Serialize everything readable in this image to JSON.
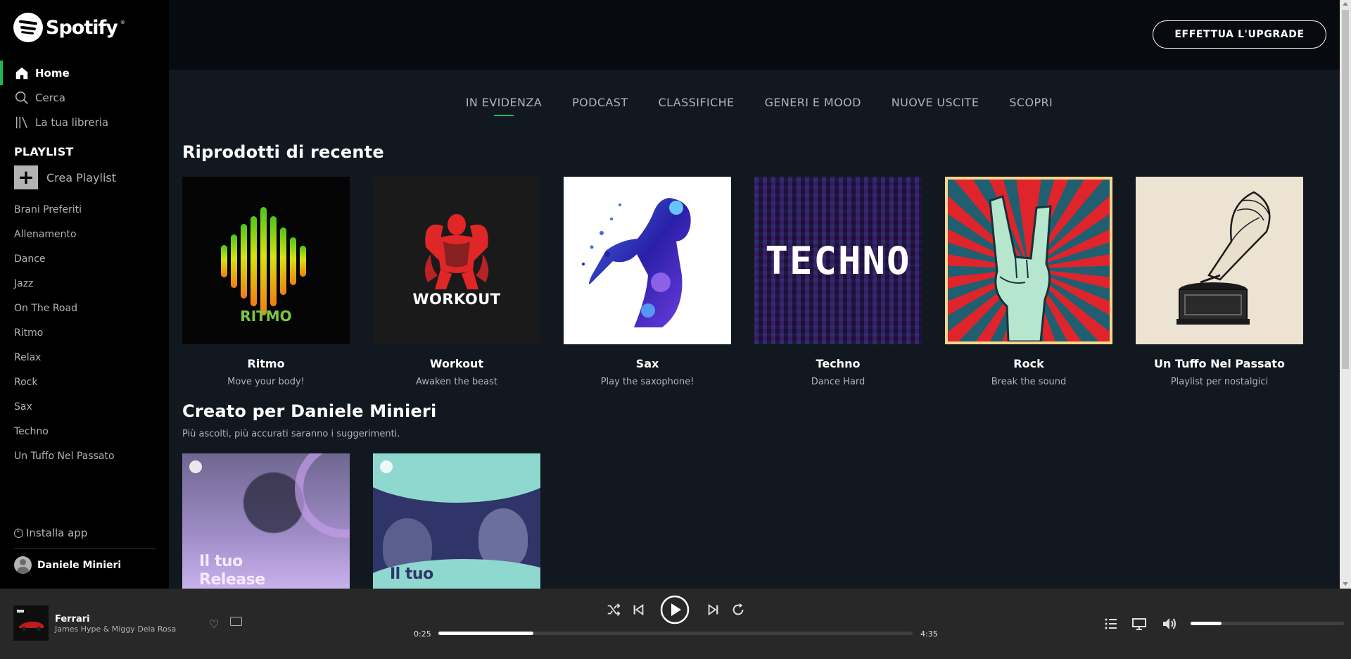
{
  "brand": {
    "name": "Spotify",
    "accent": "#1db954"
  },
  "sidebar": {
    "nav": [
      {
        "label": "Home",
        "icon": "home-icon",
        "active": true
      },
      {
        "label": "Cerca",
        "icon": "search-icon",
        "active": false
      },
      {
        "label": "La tua libreria",
        "icon": "library-icon",
        "active": false
      }
    ],
    "playlist_title": "PLAYLIST",
    "create_label": "Crea Playlist",
    "playlists": [
      "Brani Preferiti",
      "Allenamento",
      "Dance",
      "Jazz",
      "On The Road",
      "Ritmo",
      "Relax",
      "Rock",
      "Sax",
      "Techno",
      "Un Tuffo Nel Passato"
    ],
    "install_label": "Installa app",
    "user_name": "Daniele Minieri"
  },
  "header": {
    "upgrade_label": "EFFETTUA L'UPGRADE"
  },
  "tabs": [
    {
      "label": "IN EVIDENZA",
      "active": true
    },
    {
      "label": "PODCAST",
      "active": false
    },
    {
      "label": "CLASSIFICHE",
      "active": false
    },
    {
      "label": "GENERI E MOOD",
      "active": false
    },
    {
      "label": "NUOVE USCITE",
      "active": false
    },
    {
      "label": "SCOPRI",
      "active": false
    }
  ],
  "recent": {
    "title": "Riprodotti di recente",
    "cards": [
      {
        "title": "Ritmo",
        "desc": "Move your body!",
        "art_text": "RITMO"
      },
      {
        "title": "Workout",
        "desc": "Awaken the beast",
        "art_text": "WORKOUT"
      },
      {
        "title": "Sax",
        "desc": "Play the saxophone!",
        "art_text": ""
      },
      {
        "title": "Techno",
        "desc": "Dance Hard",
        "art_text": "TECHNO"
      },
      {
        "title": "Rock",
        "desc": "Break the sound",
        "art_text": ""
      },
      {
        "title": "Un Tuffo Nel Passato",
        "desc": "Playlist per nostalgici",
        "art_text": ""
      }
    ]
  },
  "made_for": {
    "title": "Creato per Daniele Minieri",
    "subtitle": "Più ascolti, più accurati saranno i suggerimenti.",
    "cards": [
      {
        "art_line1": "Il tuo",
        "art_line2": "Release"
      },
      {
        "art_line1": "Il tuo",
        "art_line2": ""
      }
    ]
  },
  "player": {
    "track": "Ferrari",
    "artist": "James Hype & Miggy Dela Rosa",
    "elapsed": "0:25",
    "duration": "4:35",
    "progress": 0.2,
    "volume": 0.2
  }
}
